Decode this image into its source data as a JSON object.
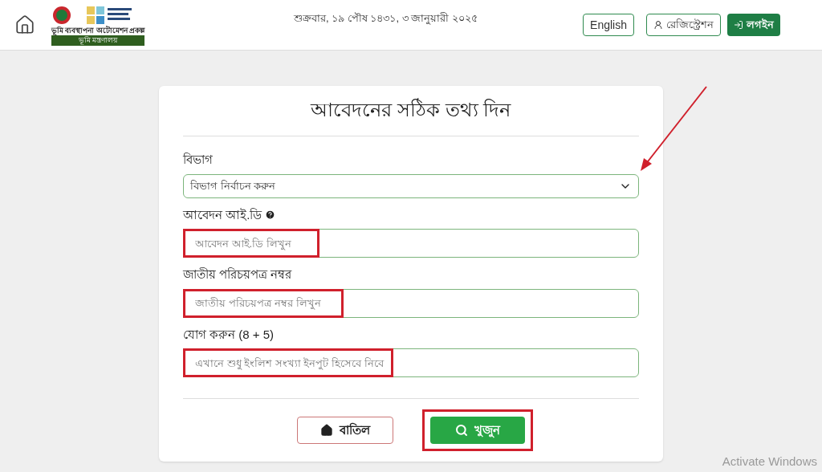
{
  "header": {
    "logo_caption": "ভূমি ব্যবস্থাপনা অটোমেশন প্রকল্প",
    "logo_ribbon": "ভূমি মন্ত্রণালয়",
    "date": "শুক্রবার, ১৯ পৌষ ১৪৩১, ৩ জানুয়ারী ২০২৫",
    "actions": [
      {
        "kind": "language",
        "label": "English"
      },
      {
        "kind": "register",
        "label": "রেজিস্ট্রেশন"
      },
      {
        "kind": "login",
        "label": "লগইন"
      }
    ]
  },
  "form": {
    "title": "আবেদনের সঠিক তথ্য দিন",
    "fields": [
      {
        "kind": "select",
        "label": "বিভাগ",
        "value": "বিভাগ নির্বাচন করুন",
        "help": false,
        "highlighted": false,
        "arrow": true
      },
      {
        "kind": "input",
        "label": "আবেদন আই.ডি",
        "placeholder": "আবেদন আই.ডি লিখুন",
        "help": true,
        "highlighted": true,
        "arrow": false
      },
      {
        "kind": "input",
        "label": "জাতীয় পরিচয়পত্র নম্বর",
        "placeholder": "জাতীয় পরিচয়পত্র নম্বর লিখুন",
        "help": false,
        "highlighted": true,
        "arrow": false
      },
      {
        "kind": "input",
        "label": "যোগ করুন (8 + 5)",
        "placeholder": "এখানে শুধু ইংলিশ সংখ্যা ইনপুট হিসেবে নিবে",
        "help": false,
        "highlighted": true,
        "arrow": false
      }
    ],
    "buttons": [
      {
        "kind": "cancel",
        "label": "বাতিল",
        "highlighted": false
      },
      {
        "kind": "search",
        "label": "খুজুন",
        "highlighted": true
      }
    ]
  },
  "os_notice": "Activate Windows"
}
